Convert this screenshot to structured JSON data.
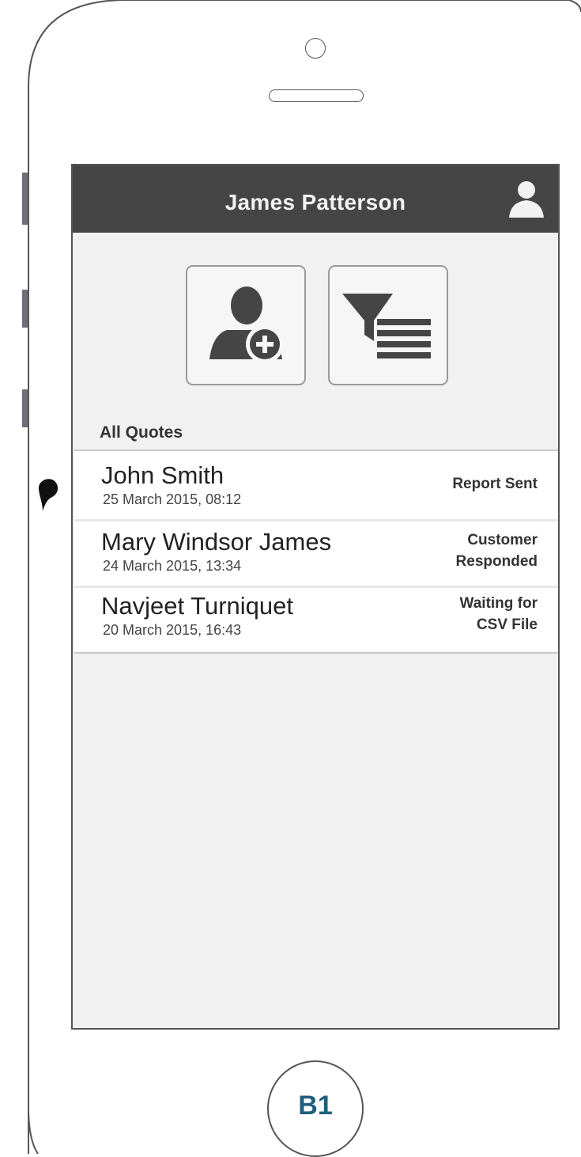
{
  "header": {
    "title": "James Patterson",
    "icon": "user-profile-icon"
  },
  "actions": [
    {
      "name": "add-customer",
      "icon": "add-person-icon"
    },
    {
      "name": "filter-list",
      "icon": "filter-list-icon"
    }
  ],
  "section": {
    "label": "All Quotes"
  },
  "quotes": [
    {
      "name": "John Smith",
      "date": "25 March 2015, 08:12",
      "status": "Report Sent"
    },
    {
      "name": "Mary Windsor James",
      "date": "24 March 2015, 13:34",
      "status": "Customer\nResponded"
    },
    {
      "name": "Navjeet Turniquet",
      "date": "20 March 2015, 16:43",
      "status": "Waiting for\nCSV File"
    }
  ],
  "home_button": {
    "label": "B1"
  },
  "colors": {
    "header_bg": "#454545",
    "screen_bg": "#f1f1f1",
    "list_bg": "#ffffff",
    "home_label": "#1d5f7d"
  }
}
